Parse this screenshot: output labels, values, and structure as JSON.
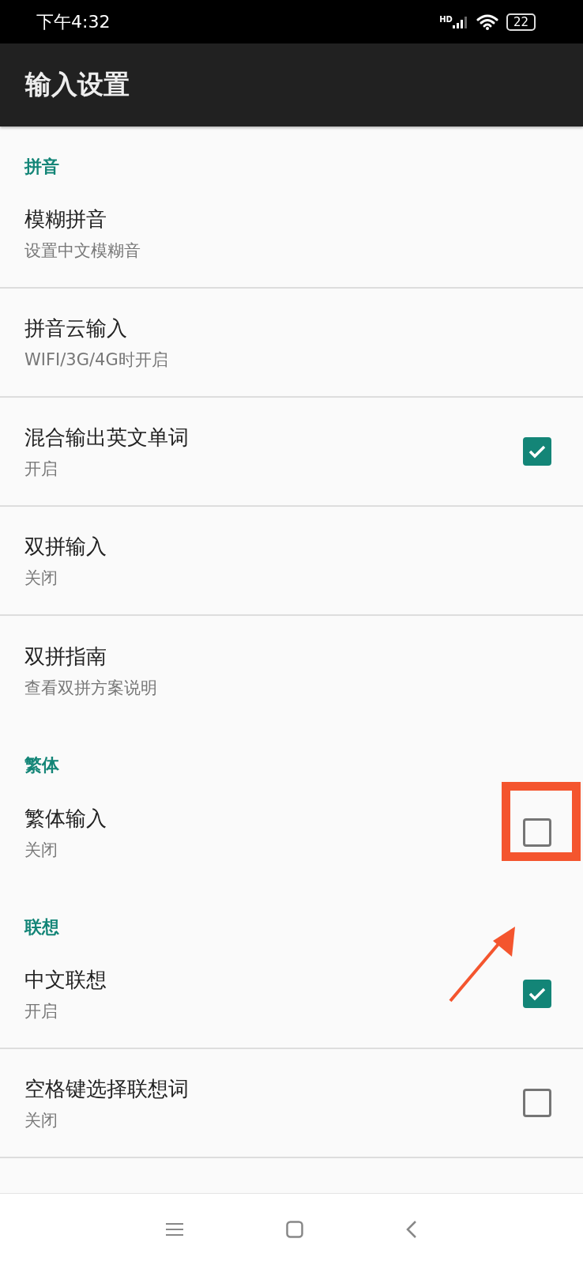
{
  "status_bar": {
    "time": "下午4:32",
    "network_label": "HD",
    "battery": "22"
  },
  "app_bar": {
    "title": "输入设置"
  },
  "sections": [
    {
      "header": "拼音",
      "items": [
        {
          "title": "模糊拼音",
          "subtitle": "设置中文模糊音",
          "kind": "plain"
        },
        {
          "title": "拼音云输入",
          "subtitle": "WIFI/3G/4G时开启",
          "kind": "plain"
        },
        {
          "title": "混合输出英文单词",
          "subtitle": "开启",
          "kind": "checkbox",
          "checked": true,
          "highlighted": false
        },
        {
          "title": "双拼输入",
          "subtitle": "关闭",
          "kind": "plain"
        },
        {
          "title": "双拼指南",
          "subtitle": "查看双拼方案说明",
          "kind": "plain"
        }
      ]
    },
    {
      "header": "繁体",
      "items": [
        {
          "title": "繁体输入",
          "subtitle": "关闭",
          "kind": "checkbox",
          "checked": false,
          "highlighted": true
        }
      ]
    },
    {
      "header": "联想",
      "items": [
        {
          "title": "中文联想",
          "subtitle": "开启",
          "kind": "checkbox",
          "checked": true,
          "highlighted": false
        },
        {
          "title": "空格键选择联想词",
          "subtitle": "关闭",
          "kind": "checkbox",
          "checked": false,
          "highlighted": false
        }
      ]
    }
  ]
}
